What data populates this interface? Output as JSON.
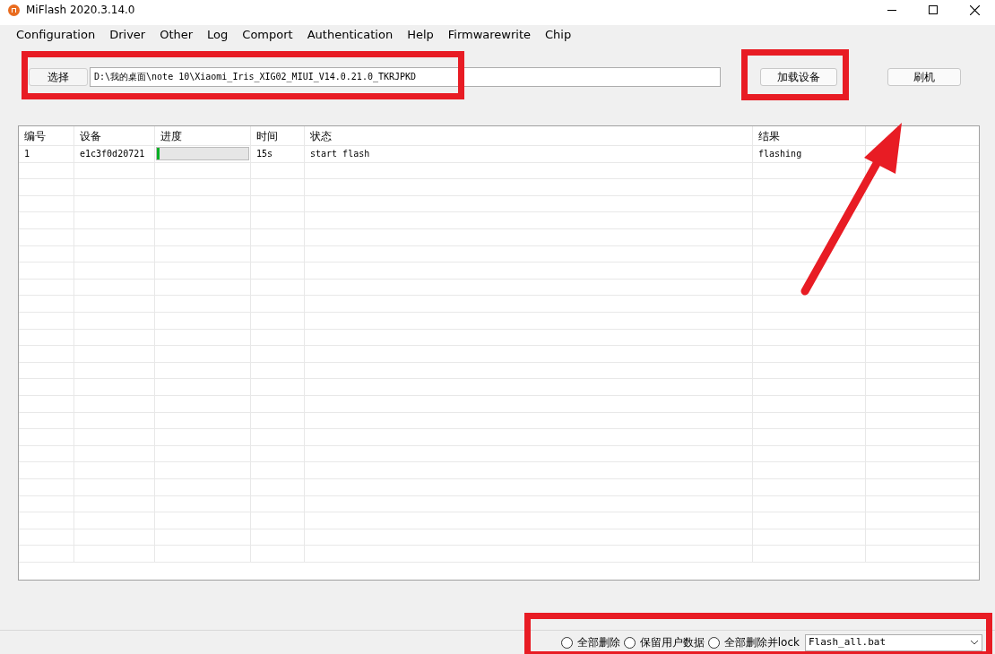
{
  "window": {
    "title": "MiFlash 2020.3.14.0"
  },
  "menu": [
    "Configuration",
    "Driver",
    "Other",
    "Log",
    "Comport",
    "Authentication",
    "Help",
    "Firmwarewrite",
    "Chip"
  ],
  "toolbar": {
    "select_button": "选择",
    "path": "D:\\我的桌面\\note 10\\Xiaomi_Iris_XIG02_MIUI_V14.0.21.0_TKRJPKD",
    "load_button": "加载设备",
    "flash_button": "刷机"
  },
  "table": {
    "columns": [
      "编号",
      "设备",
      "进度",
      "时间",
      "状态",
      "结果"
    ],
    "rows": [
      {
        "number": "1",
        "device": "e1c3f0d20721",
        "level": 0.03,
        "time": "15s",
        "status": "start flash",
        "result": "flashing"
      }
    ]
  },
  "options": [
    {
      "label": "全部删除",
      "selected": false
    },
    {
      "label": "保留用户数据",
      "selected": false
    },
    {
      "label": "全部删除并lock",
      "selected": false
    }
  ],
  "script_select": {
    "value": "Flash_all.bat"
  }
}
